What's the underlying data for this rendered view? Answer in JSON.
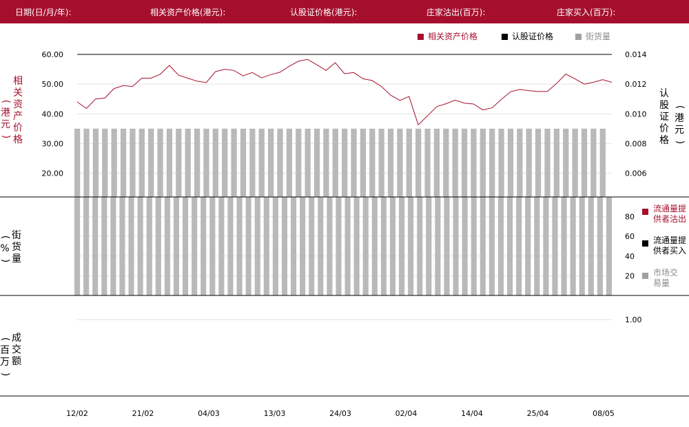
{
  "header": {
    "date_label": "日期(日/月/年):",
    "underlying_label": "相关资产价格(港元):",
    "warrant_label": "认股证价格(港元):",
    "sell_label": "庄家沽出(百万):",
    "buy_label": "庄家买入(百万):"
  },
  "colors": {
    "brand": "#a50f2d",
    "underlying_line": "#a50f2d",
    "warrant": "#000000",
    "street": "#b9b9b9"
  },
  "legend_top": {
    "underlying": "相关资产价格",
    "warrant": "认股证价格",
    "street": "街货量"
  },
  "axis_titles": {
    "left_price": [
      "相",
      "关",
      "资",
      "产",
      "价",
      "格"
    ],
    "left_price_unit": [
      "(",
      "港",
      "元",
      ")"
    ],
    "right_price": [
      "认",
      "股",
      "证",
      "价",
      "格"
    ],
    "right_price_unit": [
      "(",
      "港",
      "元",
      ")"
    ],
    "street_pct": [
      "街",
      "货",
      "量"
    ],
    "street_pct_unit": [
      "(",
      "%",
      ")"
    ],
    "turnover": [
      "成",
      "交",
      "额"
    ],
    "turnover_unit": [
      "(",
      "百",
      "万",
      ")"
    ]
  },
  "legend_mid": {
    "sell": "流通量提供者沽出",
    "buy": "流通量提供者买入",
    "market": "市场交易量"
  },
  "chart_data": [
    {
      "type": "line",
      "title": "",
      "x_labels": [
        "12/02",
        "21/02",
        "04/03",
        "13/03",
        "24/03",
        "02/04",
        "14/04",
        "25/04",
        "08/05"
      ],
      "left_axis": {
        "ticks": [
          "60.00",
          "50.00",
          "40.00",
          "30.00",
          "20.00"
        ],
        "ylim": [
          12,
          60
        ]
      },
      "right_axis": {
        "ticks": [
          "0.014",
          "0.012",
          "0.010",
          "0.008",
          "0.006"
        ],
        "ylim": [
          0.0044,
          0.014
        ]
      },
      "series": [
        {
          "name": "相关资产价格",
          "values": [
            44.0,
            41.8,
            45.0,
            45.3,
            48.5,
            49.5,
            49.2,
            52.0,
            52.0,
            53.3,
            56.3,
            53.0,
            52.0,
            51.0,
            50.5,
            54.2,
            55.0,
            54.6,
            52.8,
            53.9,
            52.1,
            53.2,
            54.0,
            56.0,
            57.7,
            58.3,
            56.5,
            54.6,
            57.2,
            53.5,
            53.9,
            51.8,
            51.2,
            49.2,
            46.3,
            44.5,
            45.8,
            36.3,
            39.3,
            42.4,
            43.4,
            44.6,
            43.6,
            43.3,
            41.3,
            42.0,
            44.8,
            47.4,
            48.2,
            47.8,
            47.5,
            47.5,
            50.2,
            53.4,
            51.8,
            50.0,
            50.6,
            51.5,
            50.6
          ]
        }
      ],
      "bars": {
        "name": "街货量",
        "values": [
          35,
          35,
          35,
          35,
          35,
          35,
          35,
          35,
          35,
          35,
          35,
          35,
          35,
          35,
          35,
          35,
          35,
          35,
          35,
          35,
          35,
          35,
          35,
          35,
          35,
          35,
          35,
          35,
          35,
          35,
          35,
          35,
          35,
          35,
          35,
          35,
          35,
          35,
          35,
          35,
          35,
          35,
          35,
          35,
          35,
          35,
          35,
          35,
          35,
          35,
          35,
          35,
          35,
          35,
          35,
          35,
          35,
          35
        ]
      }
    },
    {
      "type": "bar",
      "title": "",
      "right_axis": {
        "ticks": [
          "80",
          "60",
          "40",
          "20"
        ],
        "ylim": [
          0,
          100
        ]
      },
      "series": [
        {
          "name": "市场交易量",
          "values": [
            100,
            100,
            100,
            100,
            100,
            100,
            100,
            100,
            100,
            100,
            100,
            100,
            100,
            100,
            100,
            100,
            100,
            100,
            100,
            100,
            100,
            100,
            100,
            100,
            100,
            100,
            100,
            100,
            100,
            100,
            100,
            100,
            100,
            100,
            100,
            100,
            100,
            100,
            100,
            100,
            100,
            100,
            100,
            100,
            100,
            100,
            100,
            100,
            100,
            100,
            100,
            100,
            100,
            100,
            100,
            100,
            100,
            100,
            100,
            100
          ]
        }
      ]
    },
    {
      "type": "bar",
      "title": "",
      "right_axis": {
        "ticks": [
          "1.00"
        ]
      },
      "series": []
    }
  ]
}
